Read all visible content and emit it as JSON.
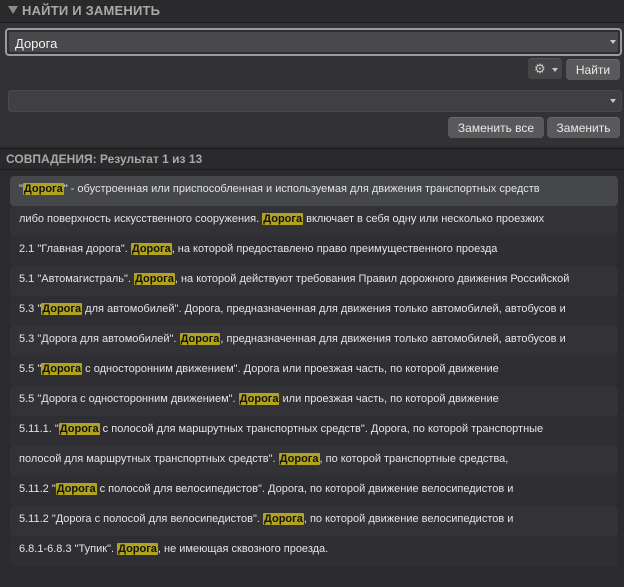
{
  "panel": {
    "title": "НАЙТИ И ЗАМЕНИТЬ"
  },
  "search": {
    "value": "Дорога"
  },
  "buttons": {
    "find": "Найти",
    "replace_all": "Заменить все",
    "replace": "Заменить"
  },
  "replace_field": {
    "value": ""
  },
  "results": {
    "header": "СОВПАДЕНИЯ: Результат 1 из 13",
    "highlight_color": "#b1a31e",
    "rows": [
      {
        "parts": [
          "\"",
          "Дорога",
          "\" - обустроенная или приспособленная и используемая для движения транспортных средств"
        ]
      },
      {
        "parts": [
          "либо поверхность искусственного сооружения. ",
          "Дорога",
          " включает в себя одну или несколько проезжих"
        ]
      },
      {
        "parts": [
          "2.1 \"Главная дорога\". ",
          "Дорога",
          ", на которой предоставлено право преимущественного проезда"
        ]
      },
      {
        "parts": [
          "5.1 \"Автомагистраль\". ",
          "Дорога",
          ", на которой действуют требования Правил дорожного движения Российской"
        ]
      },
      {
        "parts": [
          "5.3 \"",
          "Дорога",
          " для автомобилей\". Дорога, предназначенная для движения только автомобилей, автобусов и"
        ]
      },
      {
        "parts": [
          "5.3 \"Дорога для автомобилей\". ",
          "Дорога",
          ", предназначенная для движения только автомобилей, автобусов и"
        ]
      },
      {
        "parts": [
          "5.5 \"",
          "Дорога",
          " с односторонним движением\". Дорога или проезжая часть, по которой движение"
        ]
      },
      {
        "parts": [
          "5.5 \"Дорога с односторонним движением\". ",
          "Дорога",
          " или проезжая часть, по которой движение"
        ]
      },
      {
        "parts": [
          "5.11.1. \"",
          "Дорога",
          " с полосой для маршрутных транспортных средств\". Дорога, по которой транспортные"
        ]
      },
      {
        "parts": [
          "полосой для маршрутных транспортных средств\". ",
          "Дорога",
          ", по которой транспортные средства,"
        ]
      },
      {
        "parts": [
          "5.11.2 \"",
          "Дорога",
          " с полосой для велосипедистов\". Дорога, по которой движение велосипедистов и"
        ]
      },
      {
        "parts": [
          "5.11.2 \"Дорога с полосой для велосипедистов\". ",
          "Дорога",
          ", по которой движение велосипедистов и"
        ]
      },
      {
        "parts": [
          "6.8.1-6.8.3 \"Тупик\". ",
          "Дорога",
          ", не имеющая сквозного проезда."
        ]
      }
    ]
  }
}
